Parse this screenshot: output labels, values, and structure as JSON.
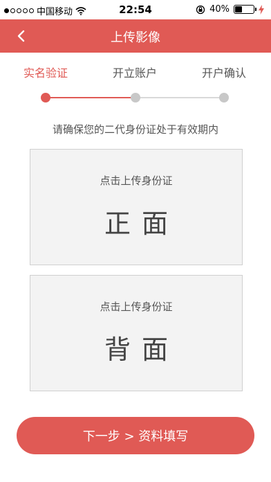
{
  "status_bar": {
    "carrier": "中国移动",
    "time": "22:54",
    "battery": "40%",
    "battery_level": 0.4
  },
  "navbar": {
    "title": "上传影像",
    "back_icon": "chevron-left-icon"
  },
  "steps": [
    {
      "label": "实名验证",
      "active": true
    },
    {
      "label": "开立账户",
      "active": false
    },
    {
      "label": "开户确认",
      "active": false
    }
  ],
  "hint": "请确保您的二代身份证处于有效期内",
  "cards": {
    "front": {
      "subtitle": "点击上传身份证",
      "title": "正面"
    },
    "back": {
      "subtitle": "点击上传身份证",
      "title": "背面"
    }
  },
  "next_button": "下一步 > 资料填写",
  "colors": {
    "accent": "#e05a55",
    "inactive": "#c8c8c8"
  }
}
